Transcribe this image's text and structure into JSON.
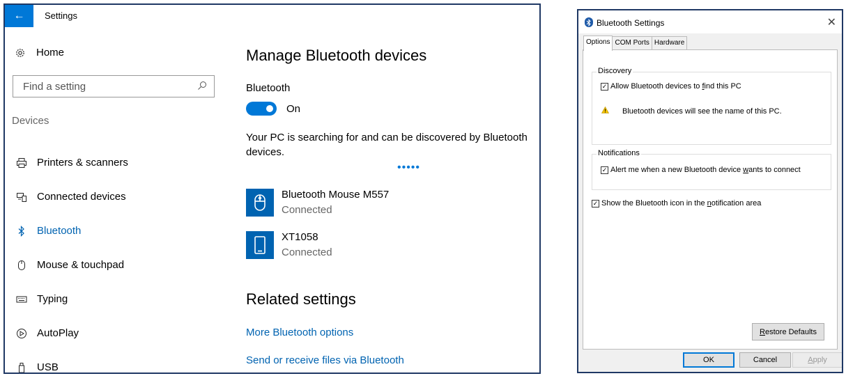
{
  "settings": {
    "window_title": "Settings",
    "home_label": "Home",
    "search_placeholder": "Find a setting",
    "section_label": "Devices",
    "nav_items": [
      {
        "label": "Printers & scanners"
      },
      {
        "label": "Connected devices"
      },
      {
        "label": "Bluetooth"
      },
      {
        "label": "Mouse & touchpad"
      },
      {
        "label": "Typing"
      },
      {
        "label": "AutoPlay"
      },
      {
        "label": "USB"
      }
    ],
    "main": {
      "heading": "Manage Bluetooth devices",
      "bluetooth_label": "Bluetooth",
      "toggle_state": "On",
      "searching_text": "Your PC is searching for and can be discovered by Bluetooth devices.",
      "devices": [
        {
          "name": "Bluetooth Mouse M557",
          "status": "Connected",
          "icon": "mouse-icon"
        },
        {
          "name": "XT1058",
          "status": "Connected",
          "icon": "phone-icon"
        }
      ],
      "related_heading": "Related settings",
      "links": [
        "More Bluetooth options",
        "Send or receive files via Bluetooth"
      ]
    }
  },
  "dialog": {
    "title": "Bluetooth Settings",
    "tabs": [
      "Options",
      "COM Ports",
      "Hardware"
    ],
    "discovery": {
      "group_title": "Discovery",
      "allow_prefix": "Allow Bluetooth devices to ",
      "allow_key": "f",
      "allow_suffix": "ind this PC",
      "allow_checked": true,
      "warning_text": "Bluetooth devices will see the name of this PC."
    },
    "notifications": {
      "group_title": "Notifications",
      "alert_prefix": "Alert me when a new Bluetooth device ",
      "alert_key": "w",
      "alert_suffix": "ants to connect",
      "alert_checked": true
    },
    "show_icon": {
      "prefix": "Show the Bluetooth icon in the ",
      "key": "n",
      "suffix": "otification area",
      "checked": true
    },
    "restore_key": "R",
    "restore_rest": "estore Defaults",
    "ok_label": "OK",
    "cancel_label": "Cancel",
    "apply_key": "A",
    "apply_rest": "pply"
  },
  "colors": {
    "accent": "#0078d7",
    "link": "#0063b1",
    "border": "#1f3864"
  }
}
